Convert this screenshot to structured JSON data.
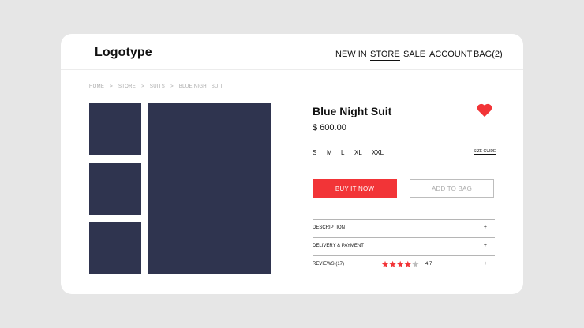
{
  "header": {
    "logo": "Logotype",
    "nav": [
      "NEW IN",
      "STORE",
      "SALE",
      "ACCOUNT",
      "BAG(2)"
    ],
    "active_nav": "STORE"
  },
  "breadcrumb": [
    "HOME",
    "STORE",
    "SUITS",
    "BLUE NIGHT SUIT"
  ],
  "breadcrumb_separator": ">",
  "product": {
    "title": "Blue Night Suit",
    "price": "$ 600.00",
    "sizes": [
      "S",
      "M",
      "L",
      "XL",
      "XXL"
    ],
    "size_guide": "SIZE GUIDE",
    "buy_label": "BUY IT NOW",
    "add_label": "ADD TO BAG",
    "favorite": true
  },
  "details": [
    {
      "label": "DESCRIPTION",
      "toggle": "+"
    },
    {
      "label": "DELIVERY & PAYMENT",
      "toggle": "+"
    },
    {
      "label": "REVIEWS (17)",
      "toggle": "+"
    }
  ],
  "reviews": {
    "stars_filled": 4,
    "stars_total": 5,
    "rating": "4.7"
  },
  "colors": {
    "accent": "#f23437",
    "image_placeholder": "#2f344f",
    "background": "#e6e6e6",
    "star_empty": "#bdbdbd"
  }
}
